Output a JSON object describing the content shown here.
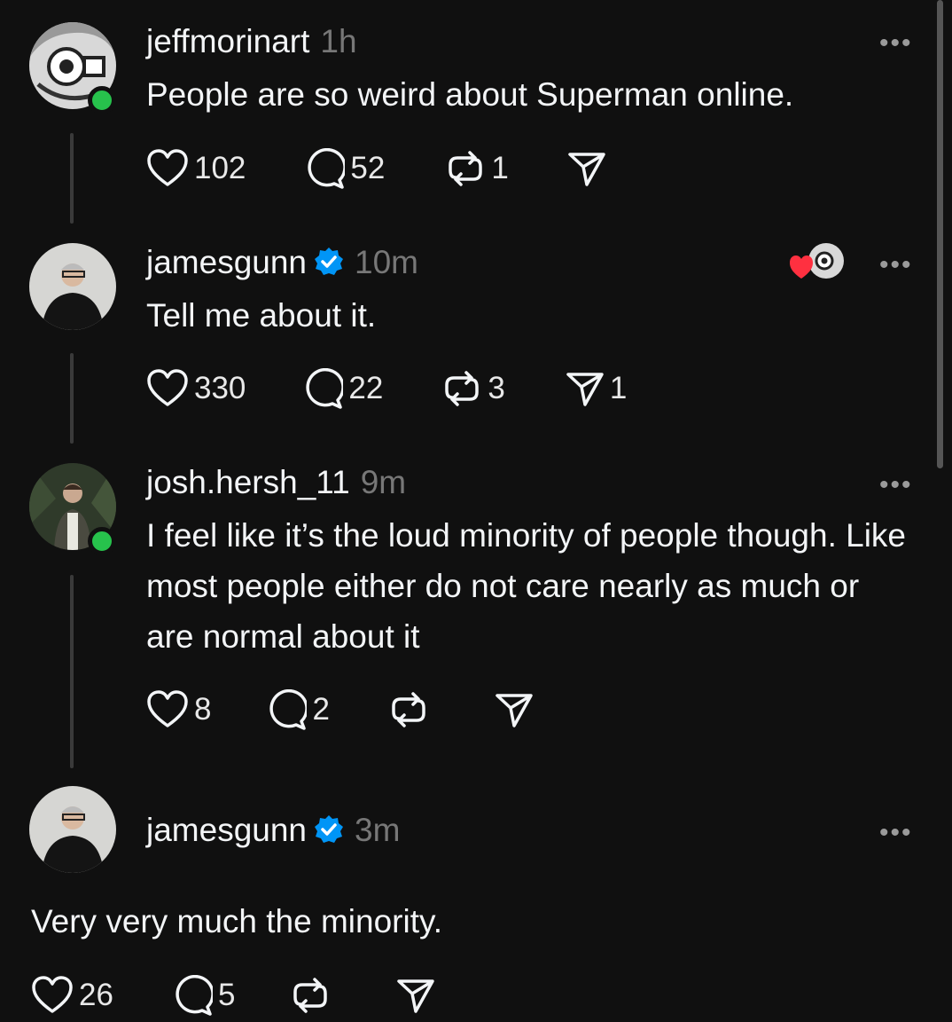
{
  "posts": [
    {
      "username": "jeffmorinart",
      "time": "1h",
      "verified": false,
      "text": "People are so weird about Superman online.",
      "likes": "102",
      "comments": "52",
      "reposts": "1",
      "shares": ""
    },
    {
      "username": "jamesgunn",
      "time": "10m",
      "verified": true,
      "text": "Tell me about it.",
      "likes": "330",
      "comments": "22",
      "reposts": "3",
      "shares": "1"
    },
    {
      "username": "josh.hersh_11",
      "time": "9m",
      "verified": false,
      "text": "I feel like it’s the loud minority of people though. Like most people either do not care nearly as much or are normal about it",
      "likes": "8",
      "comments": "2",
      "reposts": "",
      "shares": ""
    },
    {
      "username": "jamesgunn",
      "time": "3m",
      "verified": true,
      "text": "Very very much the minority.",
      "likes": "26",
      "comments": "5",
      "reposts": "",
      "shares": ""
    }
  ],
  "more_label": "•••",
  "colors": {
    "background": "#101010",
    "text": "#f3f5f7",
    "muted": "#777777",
    "verified": "#0095f6",
    "online": "#27c24c",
    "heart": "#ff3040"
  },
  "icons": [
    "heart-icon",
    "comment-icon",
    "repost-icon",
    "share-icon",
    "verified-badge-icon",
    "more-icon"
  ]
}
